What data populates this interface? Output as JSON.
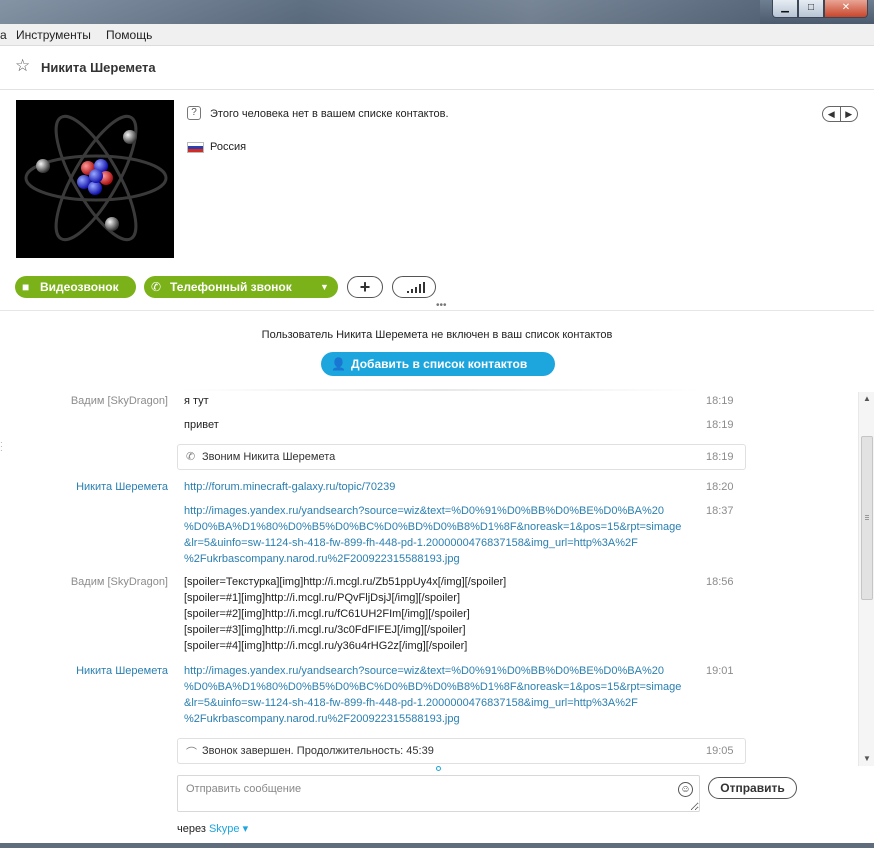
{
  "window": {
    "min": "▁",
    "max": "□",
    "close": "✕"
  },
  "menu": {
    "tools": "Инструменты",
    "help": "Помощь",
    "cut": "а"
  },
  "contact": {
    "name": "Никита Шеремета",
    "not_in_list": "Этого человека нет в вашем списке контактов.",
    "country": "Россия"
  },
  "buttons": {
    "video": "Видеозвонок",
    "phone": "Телефонный звонок",
    "plus": "+",
    "add_contact": "Добавить в список контактов",
    "send": "Отправить"
  },
  "notice": "Пользователь Никита Шеремета не включен в ваш список контактов",
  "conversation": [
    {
      "sender": "Вадим [SkyDragon]",
      "text": "я тут",
      "time": "18:19"
    },
    {
      "sender": "",
      "text": "привет",
      "time": "18:19"
    },
    {
      "call": "Звоним Никита Шеремета",
      "time": "18:19"
    },
    {
      "sender": "Никита Шеремета",
      "text": "http://forum.minecraft-galaxy.ru/topic/70239",
      "time": "18:20"
    },
    {
      "sender": "",
      "lines": [
        "http://images.yandex.ru/yandsearch?source=wiz&text=%D0%91%D0%BB%D0%BE%D0%BA%20",
        "%D0%BA%D1%80%D0%B5%D0%BC%D0%BD%D0%B8%D1%8F&noreask=1&pos=15&rpt=simage",
        "&lr=5&uinfo=sw-1124-sh-418-fw-899-fh-448-pd-1.2000000476837158&img_url=http%3A%2F",
        "%2Fukrbascompany.narod.ru%2F200922315588193.jpg"
      ],
      "time": "18:37"
    },
    {
      "sender": "Вадим [SkyDragon]",
      "lines": [
        "[spoiler=Текстурка][img]http://i.mcgl.ru/Zb51ppUy4x[/img][/spoiler]",
        "[spoiler=#1][img]http://i.mcgl.ru/PQvFljDsjJ[/img][/spoiler]",
        "[spoiler=#2][img]http://i.mcgl.ru/fC61UH2FIm[/img][/spoiler]",
        "[spoiler=#3][img]http://i.mcgl.ru/3c0FdFIFEJ[/img][/spoiler]",
        "[spoiler=#4][img]http://i.mcgl.ru/y36u4rHG2z[/img][/spoiler]"
      ],
      "time": "18:56"
    },
    {
      "sender": "Никита Шеремета",
      "lines": [
        "http://images.yandex.ru/yandsearch?source=wiz&text=%D0%91%D0%BB%D0%BE%D0%BA%20",
        "%D0%BA%D1%80%D0%B5%D0%BC%D0%BD%D0%B8%D1%8F&noreask=1&pos=15&rpt=simage",
        "&lr=5&uinfo=sw-1124-sh-418-fw-899-fh-448-pd-1.2000000476837158&img_url=http%3A%2F",
        "%2Fukrbascompany.narod.ru%2F200922315588193.jpg"
      ],
      "time": "19:01"
    },
    {
      "call": "Звонок завершен. Продолжительность: 45:39",
      "time": "19:05"
    }
  ],
  "input": {
    "placeholder": "Отправить сообщение"
  },
  "via": {
    "prefix": "через",
    "service": "Skype"
  },
  "icons": {
    "star": "star-icon",
    "not_contact": "question-icon",
    "flag": "russia-flag-icon",
    "video": "video-camera-icon",
    "phone": "phone-icon",
    "signal": "signal-bars-icon",
    "add": "add-contact-icon",
    "smiley": "smiley-icon",
    "hangup": "hangup-icon"
  },
  "colors": {
    "green": "#7bb21a",
    "blue": "#1da5dd",
    "link": "#2a7fb0",
    "gray_text": "#8c8c8c"
  }
}
